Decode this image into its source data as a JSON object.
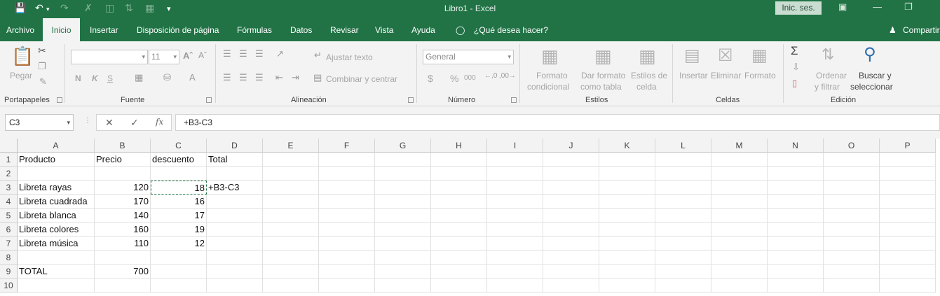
{
  "window": {
    "title": "Libro1  -  Excel",
    "signin_label": "Inic. ses."
  },
  "tabs": [
    {
      "label": "Archivo"
    },
    {
      "label": "Inicio"
    },
    {
      "label": "Insertar"
    },
    {
      "label": "Disposición de página"
    },
    {
      "label": "Fórmulas"
    },
    {
      "label": "Datos"
    },
    {
      "label": "Revisar"
    },
    {
      "label": "Vista"
    },
    {
      "label": "Ayuda"
    },
    {
      "label": "¿Qué desea hacer?"
    },
    {
      "label": "Compartir"
    }
  ],
  "ribbon": {
    "clipboard": {
      "paste": "Pegar",
      "group": "Portapapeles"
    },
    "font": {
      "font_name": "",
      "font_size": "11",
      "bold": "N",
      "italic": "K",
      "underline": "S",
      "group": "Fuente"
    },
    "alignment": {
      "wrap": "Ajustar texto",
      "merge": "Combinar y centrar",
      "group": "Alineación"
    },
    "number": {
      "format": "General",
      "currency": "$",
      "percent": "%",
      "thousands": "000",
      "inc_dec": ",0\n,00",
      "dec_dec": ",00\n,0",
      "group": "Número"
    },
    "styles": {
      "cond_format_1": "Formato",
      "cond_format_2": "condicional",
      "table_format_1": "Dar formato",
      "table_format_2": "como tabla",
      "cell_styles_1": "Estilos de",
      "cell_styles_2": "celda",
      "group": "Estilos"
    },
    "cells": {
      "insert": "Insertar",
      "delete": "Eliminar",
      "format": "Formato",
      "group": "Celdas"
    },
    "editing": {
      "sort_1": "Ordenar",
      "sort_2": "y filtrar",
      "find_1": "Buscar y",
      "find_2": "seleccionar",
      "group": "Edición"
    }
  },
  "formula_bar": {
    "name_box": "C3",
    "fx": "fx",
    "formula": "+B3-C3"
  },
  "sheet": {
    "columns": [
      "A",
      "B",
      "C",
      "D",
      "E",
      "F",
      "G",
      "H",
      "I",
      "J",
      "K",
      "L",
      "M",
      "N",
      "O",
      "P"
    ],
    "rows": [
      "1",
      "2",
      "3",
      "4",
      "5",
      "6",
      "7",
      "8",
      "9",
      "10"
    ],
    "cells": {
      "A1": "Producto",
      "B1": "Precio",
      "C1": "descuento",
      "D1": "Total",
      "A3": "Libreta rayas",
      "B3": "120",
      "C3": "18",
      "D3": "+B3-C3",
      "A4": "Libreta cuadrada",
      "B4": "170",
      "C4": "16",
      "A5": "Libreta blanca",
      "B5": "140",
      "C5": "17",
      "A6": "Libreta colores",
      "B6": "160",
      "C6": "19",
      "A7": "Libreta música",
      "B7": "110",
      "C7": "12",
      "A9": "TOTAL",
      "B9": "700"
    }
  }
}
